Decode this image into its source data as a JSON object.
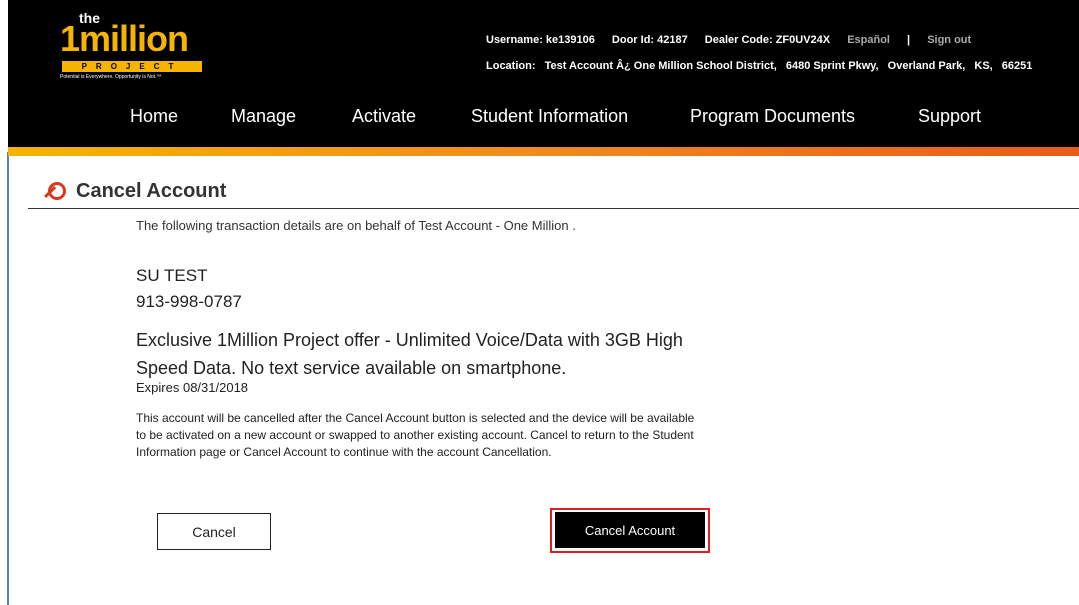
{
  "logo": {
    "the": "the",
    "brand": "1million",
    "project": "PROJECT",
    "tagline": "Potential is Everywhere. Opportunity is Not.™"
  },
  "userinfo": {
    "username": "Username: ke139106",
    "door_id": "Door Id: 42187",
    "dealer_code": "Dealer Code: ZF0UV24X",
    "language_link": "Español",
    "separator": "|",
    "sign_out": "Sign out",
    "location_label": "Location:",
    "location_parts": [
      "Test Account Â¿ One Million School District,",
      "6480 Sprint Pkwy,",
      "Overland Park,",
      "KS,",
      "66251"
    ]
  },
  "nav": {
    "items": [
      "Home",
      "Manage",
      "Activate",
      "Student Information",
      "Program Documents",
      "Support"
    ]
  },
  "page": {
    "title": "Cancel Account",
    "behalf_text": "The following transaction details are on behalf of  Test Account - One Million .",
    "name": "SU TEST",
    "phone": "913-998-0787",
    "offer": "Exclusive 1Million Project offer - Unlimited Voice/Data with 3GB High Speed Data. No text service available on smartphone.",
    "expires": "Expires  08/31/2018",
    "notice": "This account will be cancelled after the Cancel Account button is selected and the device will be available to be activated on a new account or swapped to another existing account. Cancel to return to the Student Information page or Cancel Account to continue with the account Cancellation."
  },
  "buttons": {
    "cancel": "Cancel",
    "cancel_account": "Cancel Account"
  },
  "colors": {
    "header_bg": "#000000",
    "brand_yellow": "#f5b400",
    "gradient_end": "#e85c1a",
    "highlight_red": "#e02020",
    "cancel_icon_red": "#d63a1c"
  }
}
